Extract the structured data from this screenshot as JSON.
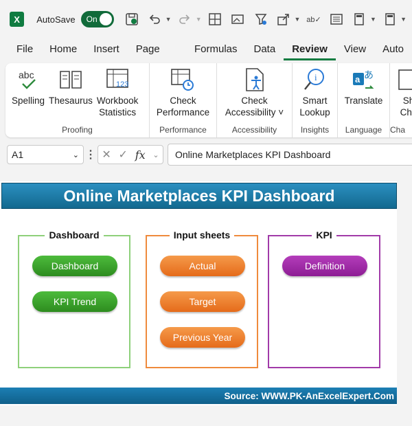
{
  "qat": {
    "autosave_label": "AutoSave",
    "toggle_state": "On"
  },
  "tabs": [
    "File",
    "Home",
    "Insert",
    "Page Layout",
    "Formulas",
    "Data",
    "Review",
    "View",
    "Auto"
  ],
  "active_tab": "Review",
  "ribbon": {
    "groups": [
      {
        "name": "Proofing",
        "buttons": [
          "Spelling",
          "Thesaurus",
          "Workbook\nStatistics"
        ]
      },
      {
        "name": "Performance",
        "buttons": [
          "Check\nPerformance"
        ]
      },
      {
        "name": "Accessibility",
        "buttons": [
          "Check\nAccessibility ˅"
        ]
      },
      {
        "name": "Insights",
        "buttons": [
          "Smart\nLookup"
        ]
      },
      {
        "name": "Language",
        "buttons": [
          "Translate"
        ]
      },
      {
        "name": "Cha",
        "buttons": [
          "Sh\nCha"
        ]
      }
    ],
    "spelling_icon_text": "abc",
    "stats_icon_text": "123"
  },
  "formula_bar": {
    "cell_ref": "A1",
    "formula": "Online Marketplaces KPI Dashboard"
  },
  "dashboard": {
    "title": "Online Marketplaces KPI Dashboard",
    "sections": [
      {
        "header": "Dashboard",
        "buttons": [
          "Dashboard",
          "KPI Trend"
        ]
      },
      {
        "header": "Input sheets",
        "buttons": [
          "Actual",
          "Target",
          "Previous Year"
        ]
      },
      {
        "header": "KPI",
        "buttons": [
          "Definition"
        ]
      }
    ],
    "source": "Source: WWW.PK-AnExcelExpert.Com"
  },
  "colors": {
    "excel_green": "#107c41",
    "title_blue": "#1b7eb0",
    "green": "#3fa92f",
    "orange": "#ee7a2b",
    "purple": "#9b2aa2"
  }
}
